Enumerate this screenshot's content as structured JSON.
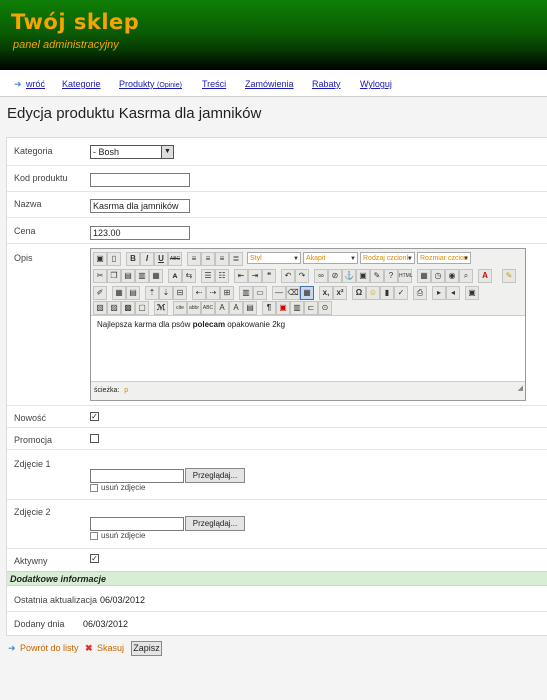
{
  "header": {
    "title": "Twój sklep",
    "subtitle": "panel administracyjny"
  },
  "nav": {
    "back": "wróć",
    "items": [
      "Kategorie",
      "Produkty",
      "Treści",
      "Zamówienia",
      "Rabaty",
      "Wyloguj"
    ],
    "reviews": "(Opinie)"
  },
  "page": {
    "title": "Edycja produktu Kasrma dla jamników"
  },
  "form": {
    "category_label": "Kategoria",
    "category_value": "- Bosh",
    "code_label": "Kod produktu",
    "code_value": "",
    "name_label": "Nazwa",
    "name_value": "Kasrma dla jamników",
    "price_label": "Cena",
    "price_value": "123.00",
    "description_label": "Opis",
    "new_label": "Nowość",
    "new_checked": true,
    "promo_label": "Promocja",
    "promo_checked": false,
    "photo1_label": "Zdjęcie 1",
    "photo2_label": "Zdjęcie 2",
    "browse_label": "Przeglądaj...",
    "remove_photo_label": "usuń zdjęcie",
    "active_label": "Aktywny",
    "active_checked": true
  },
  "editor": {
    "style_dropdown": "Styl",
    "paragraph_dropdown": "Akapit",
    "font_dropdown": "Rodzaj czcionk",
    "size_dropdown": "Rozmiar czcion",
    "content_before": "Najlepsza karma dla psów ",
    "content_bold": "polecam",
    "content_after": " opakowanie 2kg",
    "path_label": "ścieżka:",
    "path_value": "p"
  },
  "extra": {
    "section_title": "Dodatkowe informacje",
    "updated_label": "Ostatnia aktualizacja",
    "updated_value": "06/03/2012",
    "added_label": "Dodany dnia",
    "added_value": "06/03/2012"
  },
  "actions": {
    "back_to_list": "Powrót do listy",
    "delete": "Skasuj",
    "save": "Zapisz"
  }
}
